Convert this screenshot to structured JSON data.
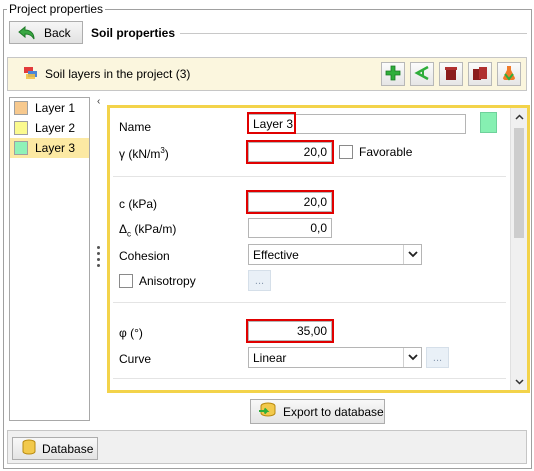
{
  "window": {
    "group_title": "Project properties"
  },
  "header": {
    "back_label": "Back",
    "section_title": "Soil properties"
  },
  "toolbar": {
    "title": "Soil layers in the project (3)"
  },
  "layers": [
    {
      "label": "Layer 1",
      "color": "#f7c98e"
    },
    {
      "label": "Layer 2",
      "color": "#fbfa8e"
    },
    {
      "label": "Layer 3",
      "color": "#8ff2b8"
    }
  ],
  "selected_layer": "Layer 3",
  "properties": {
    "name_label": "Name",
    "name_value": "Layer 3",
    "layer_color": "#86f0b2",
    "gamma_label": "γ (kN/m",
    "gamma_sup": "3",
    "gamma_close": ")",
    "gamma_value": "20,0",
    "favorable_label": "Favorable",
    "favorable_checked": false,
    "c_label": "c (kPa)",
    "c_value": "20,0",
    "delta_c_symbol": "Δ",
    "delta_c_sub": "c",
    "delta_c_unit": " (kPa/m)",
    "delta_c_value": "0,0",
    "cohesion_label": "Cohesion",
    "cohesion_value": "Effective",
    "anisotropy_label": "Anisotropy",
    "anisotropy_checked": false,
    "anisotropy_button": "...",
    "phi_label": "φ (°)",
    "phi_value": "35,00",
    "curve_label": "Curve",
    "curve_value": "Linear",
    "curve_button": "..."
  },
  "actions": {
    "export_label": "Export to database",
    "database_label": "Database"
  },
  "colors": {
    "panel_highlight": "#f3d34a",
    "field_highlight": "#e00000",
    "toolbar_bg": "#fbf6de",
    "selected_row": "#fce9a3"
  }
}
